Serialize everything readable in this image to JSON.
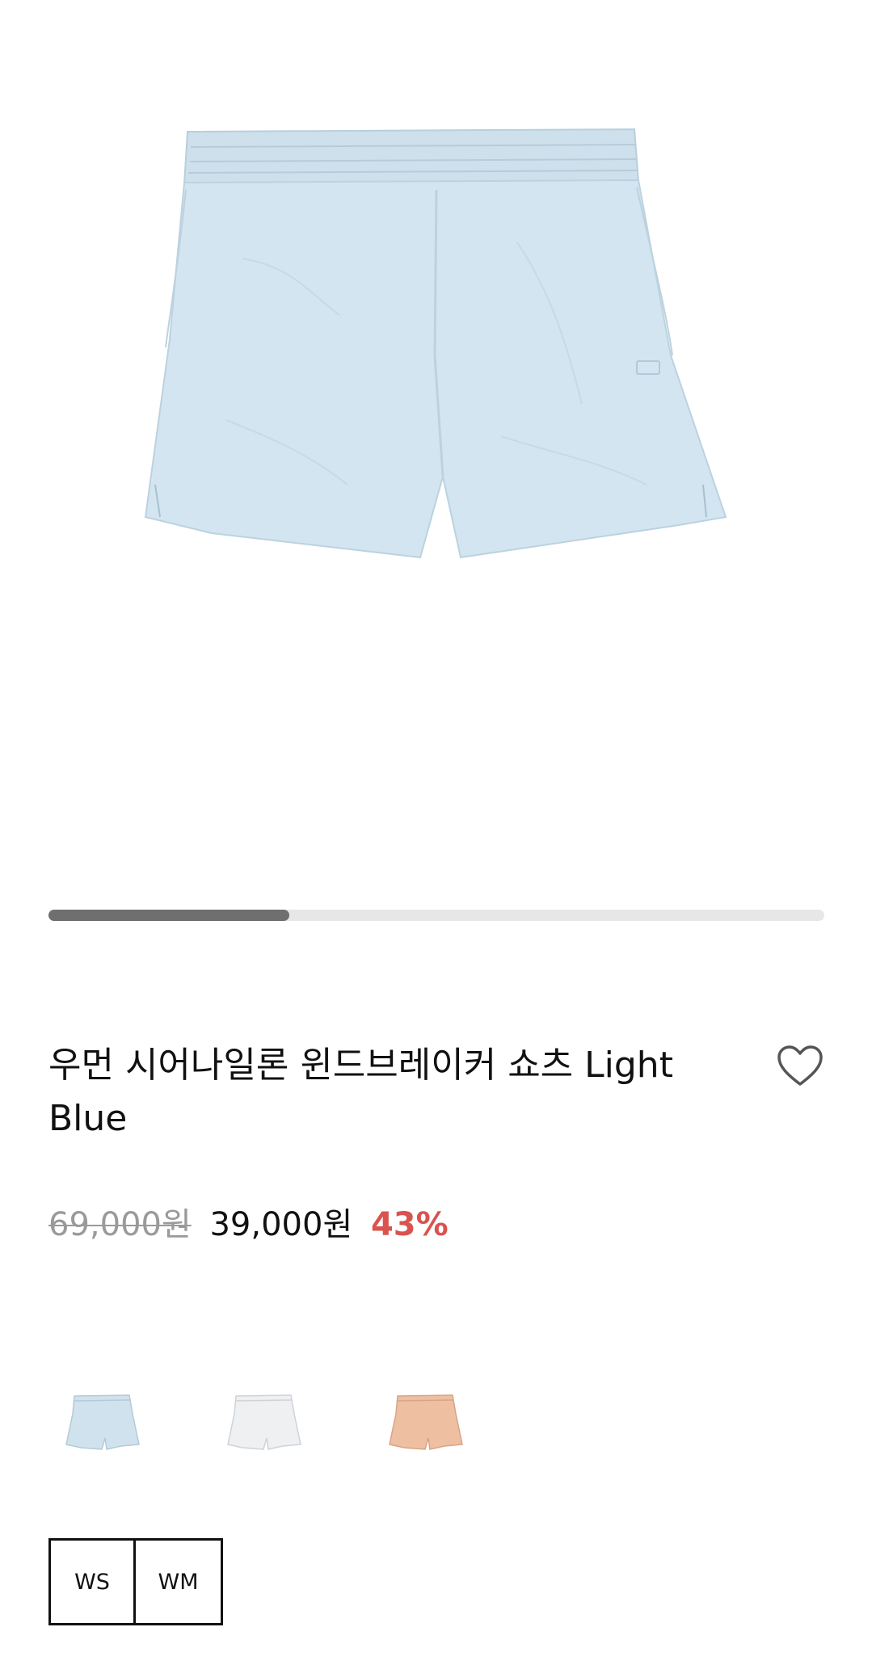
{
  "gallery": {
    "progress_fraction": 0.31,
    "main_image": "light-blue-shorts-image"
  },
  "product": {
    "title": "우먼 시어나일론 윈드브레이커 쇼츠 Light Blue",
    "price_original": "69,000원",
    "price_sale": "39,000원",
    "discount": "43%"
  },
  "colors": {
    "light_blue": "#cfe2ee",
    "white": "#eef0f2",
    "peach": "#eebfa0",
    "discount_red": "#d9534f",
    "progress_fill": "#6f6f6f",
    "progress_track": "#e7e7e7"
  },
  "swatches": [
    {
      "name": "light-blue-swatch",
      "color": "#cfe2ee"
    },
    {
      "name": "white-swatch",
      "color": "#eef0f2"
    },
    {
      "name": "peach-swatch",
      "color": "#eebfa0"
    }
  ],
  "sizes": [
    "WS",
    "WM"
  ],
  "icons": {
    "wishlist": "heart-outline-icon"
  }
}
